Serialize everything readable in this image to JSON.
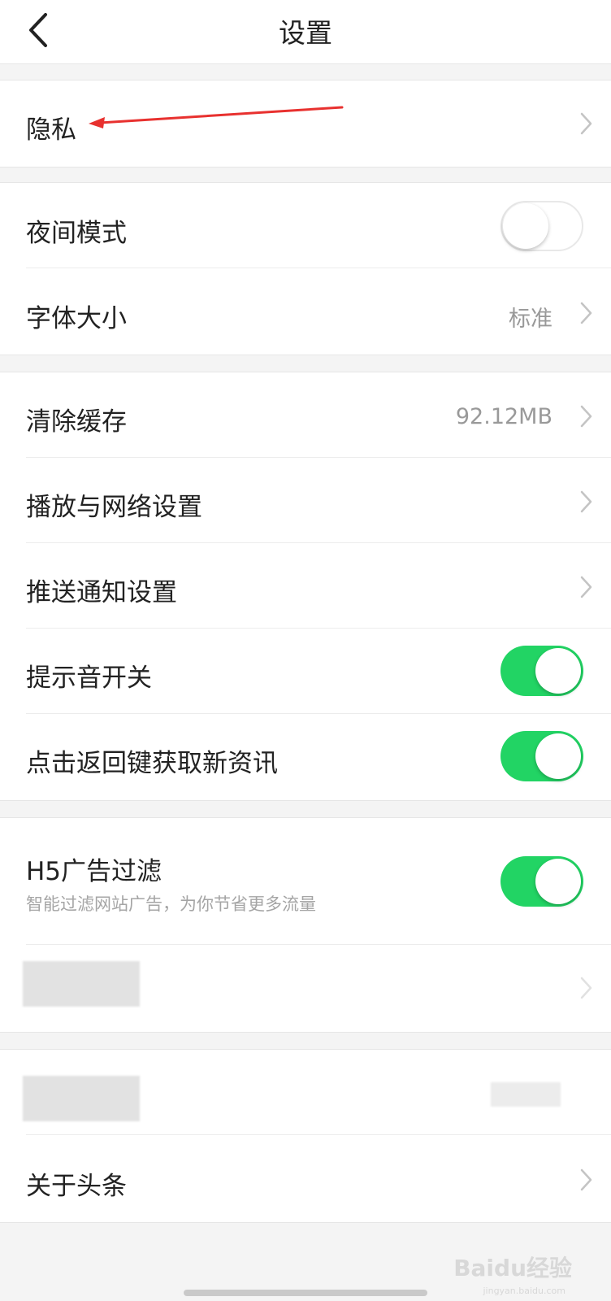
{
  "header": {
    "title": "设置",
    "back_icon": "chevron-left-icon"
  },
  "groups": {
    "privacy": {
      "label": "隐私"
    },
    "display": {
      "night_mode": {
        "label": "夜间模式",
        "enabled": false
      },
      "font_size": {
        "label": "字体大小",
        "value": "标准"
      }
    },
    "general": {
      "clear_cache": {
        "label": "清除缓存",
        "value": "92.12MB"
      },
      "playback_network": {
        "label": "播放与网络设置"
      },
      "push_notification": {
        "label": "推送通知设置"
      },
      "sound_switch": {
        "label": "提示音开关",
        "enabled": true
      },
      "back_refresh": {
        "label": "点击返回键获取新资讯",
        "enabled": true
      }
    },
    "filter": {
      "h5_ad_filter": {
        "label": "H5广告过滤",
        "sublabel": "智能过滤网站广告，为你节省更多流量",
        "enabled": true
      }
    },
    "about": {
      "label": "关于头条"
    }
  },
  "watermark": {
    "text": "Baidu经验",
    "sub": "jingyan.baidu.com"
  },
  "colors": {
    "toggle_on": "#22d464",
    "annotation_arrow": "#e8312f"
  }
}
